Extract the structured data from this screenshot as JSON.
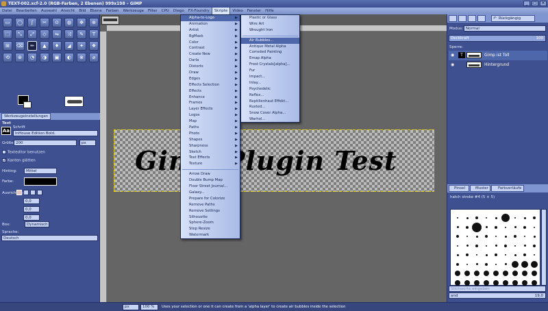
{
  "title": "TEXT-002.xcf-2.0 (RGB-Farben, 2 Ebenen) 999x198 – GIMP",
  "menubar": [
    "Datei",
    "Bearbeiten",
    "Auswahl",
    "Ansicht",
    "Bild",
    "Ebene",
    "Farben",
    "Werkzeuge",
    "Filter",
    "CPU",
    "Diego",
    "FX-Foundry",
    "Skripte",
    "Video",
    "Fenster",
    "Hilfe"
  ],
  "menubar_active": "Skripte",
  "toolbox": {
    "tools": [
      "▭",
      "◯",
      "ʃ",
      "✂",
      "⊙",
      "◍",
      "✥",
      "⊕",
      "⬚",
      "⤡",
      "⤢",
      "◇",
      "⇋",
      "⤨",
      "✎",
      "T",
      "⊞",
      "⌫",
      "✏",
      "▲",
      "♦",
      "◢",
      "✦",
      "❖",
      "⟲",
      "⊛",
      "◔",
      "◑",
      "▣",
      "◐",
      "⊗",
      "⌀"
    ],
    "tab_label": "Werkzeugeinstellungen",
    "section_label": "Text",
    "font_label": "Schrift",
    "font_value": "InHouse Edition Bold.",
    "size_label": "Größe:",
    "size_value": "200",
    "size_unit": "px",
    "editor_label": "Texteditor benutzen",
    "antialias_label": "Kanten glätten",
    "hinting_label": "Hinting:",
    "hinting_value": "Mittel",
    "color_label": "Farbe:",
    "justify_label": "Ausrichtung:",
    "indent_value": "0,0",
    "line_value": "0,0",
    "letter_value": "0,0",
    "box_label": "Box:",
    "box_value": "Dynamisch",
    "lang_label": "Sprache:",
    "lang_value": "Deutsch"
  },
  "canvas": {
    "text": "Gimp Plugin Test"
  },
  "menu1": {
    "items_top": [
      "Alpha-to-Logo",
      "Animation",
      "Artist",
      "BgMask",
      "Color",
      "Contrast",
      "Create New",
      "Darla",
      "Distorts",
      "Draw",
      "Edges",
      "Effects Selection",
      "Effects",
      "Enhance",
      "Frames",
      "Layer Effects",
      "Logos",
      "Map",
      "Paths",
      "Photo",
      "Shapes",
      "Sharpness",
      "Sketch",
      "Text Effects",
      "Texture"
    ],
    "items_bottom": [
      "Arrow Draw",
      "Double Bump Map",
      "Floor Street Journal...",
      "Galaxy...",
      "Prepare for Colorize",
      "Remove Paths",
      "Remove Settings",
      "Silhouette",
      "Sphere-Zoom",
      "Step Resize",
      "Watermark"
    ],
    "highlight": "Alpha-to-Logo"
  },
  "menu2": {
    "items_top": [
      "Plastic or Glass",
      "Wire Art",
      "Wrought Iron"
    ],
    "items_bottom": [
      "Air Bubbles...",
      "Antique Metal Alpha",
      "Corroded Painting",
      "Emap Alpha",
      "Frost Crystals[alpha]...",
      "Fur",
      "Impact...",
      "Inlay...",
      "Psychedelic",
      "Reflex...",
      "Reptilienhaut Effekt...",
      "Rusted...",
      "Snow Cover Alpha...",
      "Warhol..."
    ],
    "highlight": "Air Bubbles..."
  },
  "dock": {
    "undo_label": "Rückgängig",
    "mode_label": "Modus:",
    "mode_value": "Normal",
    "opacity_label": "Deckkraft",
    "opacity_value": "100",
    "lock_label": "Sperre:",
    "layers": [
      "Gimp ist Toll",
      "Hintergrund"
    ],
    "brush_tabs": [
      "Pinsel",
      "Muster",
      "Farbverläufe"
    ],
    "brush_name": "hatch stroke #4 (5 × 5)",
    "brush_search_placeholder": "Stichworte eingeben",
    "spacing_label": "and",
    "spacing_value": "19,0"
  },
  "status": {
    "unit": "px",
    "zoom": "100 %",
    "message": "Uses your selection or one it can create from a 'alpha layer' to create air bubbles inside the selection"
  }
}
